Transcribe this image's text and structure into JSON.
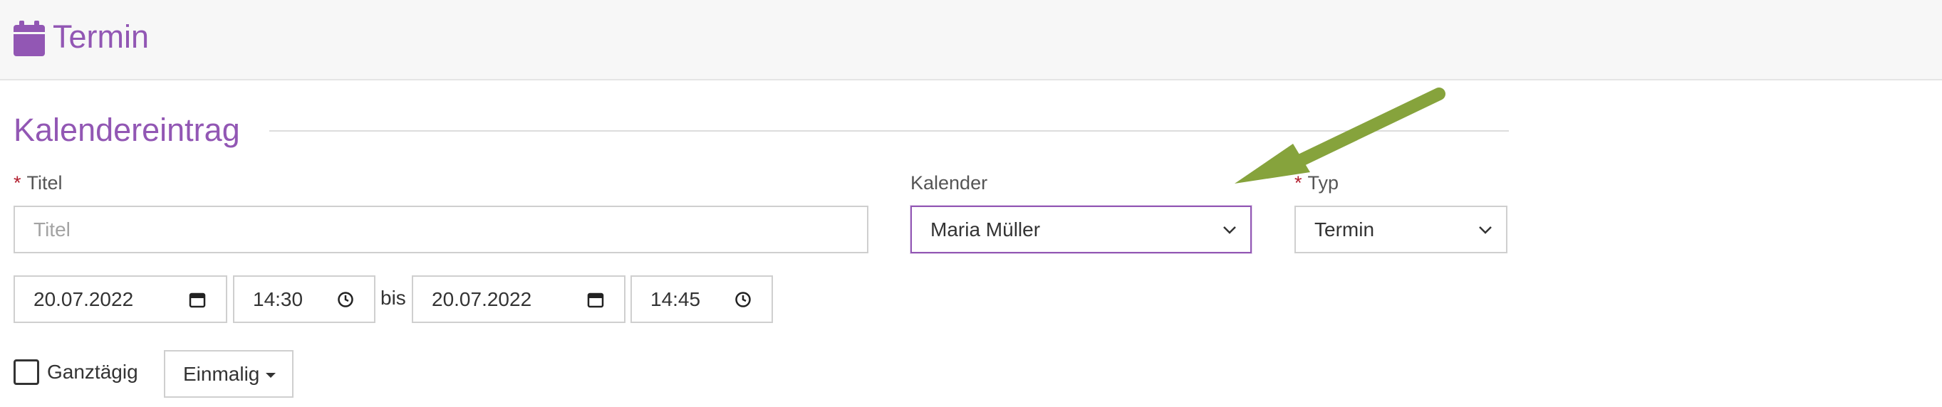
{
  "header": {
    "title": "Termin",
    "icon": "calendar-icon"
  },
  "section": {
    "legend": "Kalendereintrag"
  },
  "fields": {
    "title": {
      "label": "Titel",
      "required_mark": "*",
      "placeholder": "Titel",
      "value": ""
    },
    "calendar": {
      "label": "Kalender",
      "value": "Maria Müller"
    },
    "type": {
      "label": "Typ",
      "required_mark": "*",
      "value": "Termin"
    },
    "start_date": "20.07.2022",
    "start_time": "14:30",
    "separator": "bis",
    "end_date": "20.07.2022",
    "end_time": "14:45"
  },
  "allday": {
    "label": "Ganztägig",
    "checked": false
  },
  "recurrence": {
    "label": "Einmalig"
  },
  "annotation": {
    "color": "#86a33c",
    "points_to": "calendar-select"
  },
  "colors": {
    "accent": "#9257b4",
    "required": "#b21e2e"
  }
}
